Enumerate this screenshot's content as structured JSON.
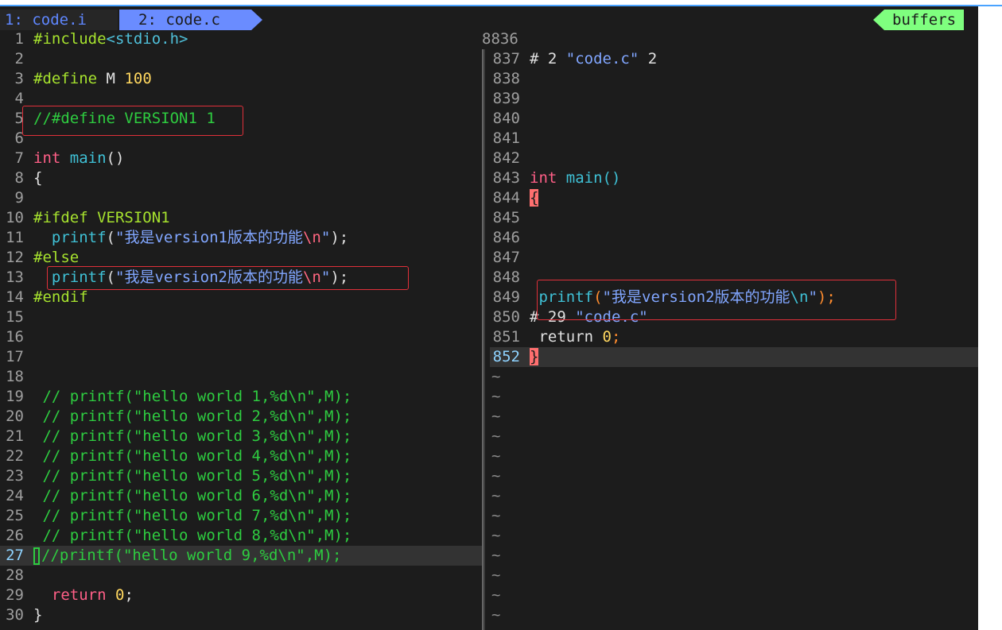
{
  "tabs": [
    {
      "label": "1: code.i"
    },
    {
      "label": "2: code.c"
    }
  ],
  "buffers_label": "buffers",
  "left_pane": {
    "cursor_line": "27",
    "lines": [
      {
        "n": "1",
        "t": "#include<stdio.h>"
      },
      {
        "n": "2",
        "t": ""
      },
      {
        "n": "3",
        "t": "#define M 100"
      },
      {
        "n": "4",
        "t": ""
      },
      {
        "n": "5",
        "t": "//#define VERSION1 1"
      },
      {
        "n": "6",
        "t": ""
      },
      {
        "n": "7",
        "t": "int main()"
      },
      {
        "n": "8",
        "t": "{"
      },
      {
        "n": "9",
        "t": ""
      },
      {
        "n": "10",
        "t": "#ifdef VERSION1"
      },
      {
        "n": "11",
        "t": "  printf(\"我是version1版本的功能\\n\");"
      },
      {
        "n": "12",
        "t": "#else"
      },
      {
        "n": "13",
        "t": "  printf(\"我是version2版本的功能\\n\");"
      },
      {
        "n": "14",
        "t": "#endif"
      },
      {
        "n": "15",
        "t": ""
      },
      {
        "n": "16",
        "t": ""
      },
      {
        "n": "17",
        "t": ""
      },
      {
        "n": "18",
        "t": ""
      },
      {
        "n": "19",
        "t": " // printf(\"hello world 1,%d\\n\",M);"
      },
      {
        "n": "20",
        "t": " // printf(\"hello world 2,%d\\n\",M);"
      },
      {
        "n": "21",
        "t": " // printf(\"hello world 3,%d\\n\",M);"
      },
      {
        "n": "22",
        "t": " // printf(\"hello world 4,%d\\n\",M);"
      },
      {
        "n": "23",
        "t": " // printf(\"hello world 5,%d\\n\",M);"
      },
      {
        "n": "24",
        "t": " // printf(\"hello world 6,%d\\n\",M);"
      },
      {
        "n": "25",
        "t": " // printf(\"hello world 7,%d\\n\",M);"
      },
      {
        "n": "26",
        "t": " // printf(\"hello world 8,%d\\n\",M);"
      },
      {
        "n": "27",
        "t": "//printf(\"hello world 9,%d\\n\",M);"
      },
      {
        "n": "28",
        "t": ""
      },
      {
        "n": "29",
        "t": "  return 0;"
      },
      {
        "n": "30",
        "t": "}"
      }
    ]
  },
  "right_pane": {
    "top_number": "8836",
    "cursor_line": "852",
    "lines": [
      {
        "n": "837",
        "t": "# 2 \"code.c\" 2"
      },
      {
        "n": "838",
        "t": ""
      },
      {
        "n": "839",
        "t": ""
      },
      {
        "n": "840",
        "t": ""
      },
      {
        "n": "841",
        "t": ""
      },
      {
        "n": "842",
        "t": ""
      },
      {
        "n": "843",
        "t": "int main()"
      },
      {
        "n": "844",
        "t": "{"
      },
      {
        "n": "845",
        "t": ""
      },
      {
        "n": "846",
        "t": ""
      },
      {
        "n": "847",
        "t": ""
      },
      {
        "n": "848",
        "t": ""
      },
      {
        "n": "849",
        "t": " printf(\"我是version2版本的功能\\n\");"
      },
      {
        "n": "850",
        "t": "# 29 \"code.c\""
      },
      {
        "n": "851",
        "t": " return 0;"
      },
      {
        "n": "852",
        "t": "}"
      }
    ],
    "tilde": "~",
    "tilde_count": 13
  },
  "colors": {
    "background": "#1c1c1c",
    "keyword": "#ff5f87",
    "function": "#3fc1d6",
    "comment": "#2ecc40",
    "string": "#81a6ff",
    "number": "#ffd75f",
    "highlight_box": "#e0303a",
    "buffers_badge": "#7fff7f",
    "active_tab": "#6a8cff"
  }
}
